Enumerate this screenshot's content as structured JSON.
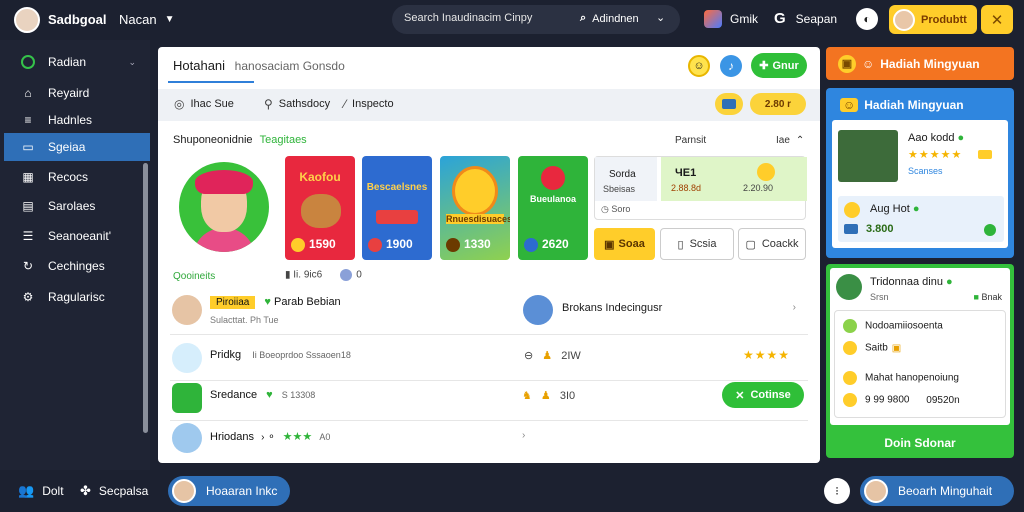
{
  "topbar": {
    "app_title": "Sadbgoal",
    "menu_label": "Nacan",
    "search_placeholder": "Search Inaudinacim Cinpy",
    "search_label": "Adindnen",
    "games_label": "Gmik",
    "support_label": "Seapan",
    "profile_label": "Produbtt"
  },
  "sidebar": {
    "items": [
      {
        "label": "Radian",
        "icon": "circle-icon"
      },
      {
        "label": "Reyaird",
        "icon": "home-icon"
      },
      {
        "label": "Hadnles",
        "icon": "list-icon"
      },
      {
        "label": "Sgeiaa",
        "icon": "folder-icon"
      },
      {
        "label": "Recocs",
        "icon": "grid-icon"
      },
      {
        "label": "Sarolaes",
        "icon": "document-icon"
      },
      {
        "label": "Seanoeanit'",
        "icon": "table-icon"
      },
      {
        "label": "Cechinges",
        "icon": "refresh-icon"
      },
      {
        "label": "Ragularisc",
        "icon": "gear-icon"
      }
    ],
    "active_index": 3
  },
  "main": {
    "title": "Hotahani",
    "subtitle": "hanosaciam Gonsdo",
    "header_button": "Gnur",
    "tabs": [
      "Ihac Sue",
      "Sathsdocy",
      "Inspecto"
    ],
    "pill_value": "2.80 r",
    "section_title": "Shuponeonidnie",
    "section_accent": "Teagitaes",
    "section_right_1": "Parnsit",
    "section_right_2": "Iae",
    "online_label": "Qooineits",
    "mini_stat_1": "Ii. 9ic6",
    "mini_stat_2": "0",
    "cards": [
      {
        "title": "Kaofou",
        "value": "1590",
        "bg": "#e8283e"
      },
      {
        "title": "Bescaelsnes",
        "value": "1900",
        "bg": "#2d6bd0"
      },
      {
        "title": "Rnuesdisuaces",
        "value": "1330",
        "bg": "#2ba3d9"
      },
      {
        "title": "Bueulanoa",
        "value": "2620",
        "bg": "#2fb43a"
      }
    ],
    "info_box": {
      "left_title": "Sorda",
      "left_sub": "Sbeisas",
      "right_title": "ЧЕ1",
      "right_sub": "2.88.8d",
      "right_sub2": "2.20.90",
      "footer": "Soro"
    },
    "action_buttons": {
      "primary": "Soaa",
      "b2": "Scsia",
      "b3": "Coackk"
    },
    "rows": [
      {
        "badge": "Piroiiaa",
        "name": "Parab Bebian",
        "meta": "Sulacttat. Ph Tue",
        "right_name": "Brokans Indecingusr"
      },
      {
        "name": "Pridkg",
        "meta": "Ii Boeoprdoo Sssaoen18",
        "right_value": "2IW"
      },
      {
        "name": "Sredance",
        "meta": "S 13308",
        "right_value": "3I0",
        "right_button": "Cotinse"
      },
      {
        "name": "Hriodans",
        "meta": "A0"
      }
    ]
  },
  "rightcol": {
    "header": "Hadiah Mingyuan",
    "box1_title": "Hadiah Mingyuan",
    "box1_item1_name": "Aao kodd",
    "box1_item1_tag": "Scanses",
    "box1_item2_name": "Aug Hot",
    "box1_item2_value": "3.800",
    "box2_name": "Tridonnaa dinu",
    "box2_sub": "Srsn",
    "box2_status": "Bnak",
    "box2_line1": "Nodoamiiosoenta",
    "box2_line2": "Saitb",
    "box2_line3": "Mahat hanopenoiung",
    "box2_line4_a": "9 99 9800",
    "box2_line4_b": "09520n",
    "box2_button": "Doin Sdonar"
  },
  "bottom": {
    "item1": "Dolt",
    "item2": "Secpalsa",
    "pill1": "Hoaaran Inkc",
    "pill2": "Beoarh Minguhait"
  },
  "colors": {
    "accent": "#2f6fb7",
    "green": "#2fbf38",
    "yellow": "#ffcd2a",
    "orange": "#f37421"
  }
}
